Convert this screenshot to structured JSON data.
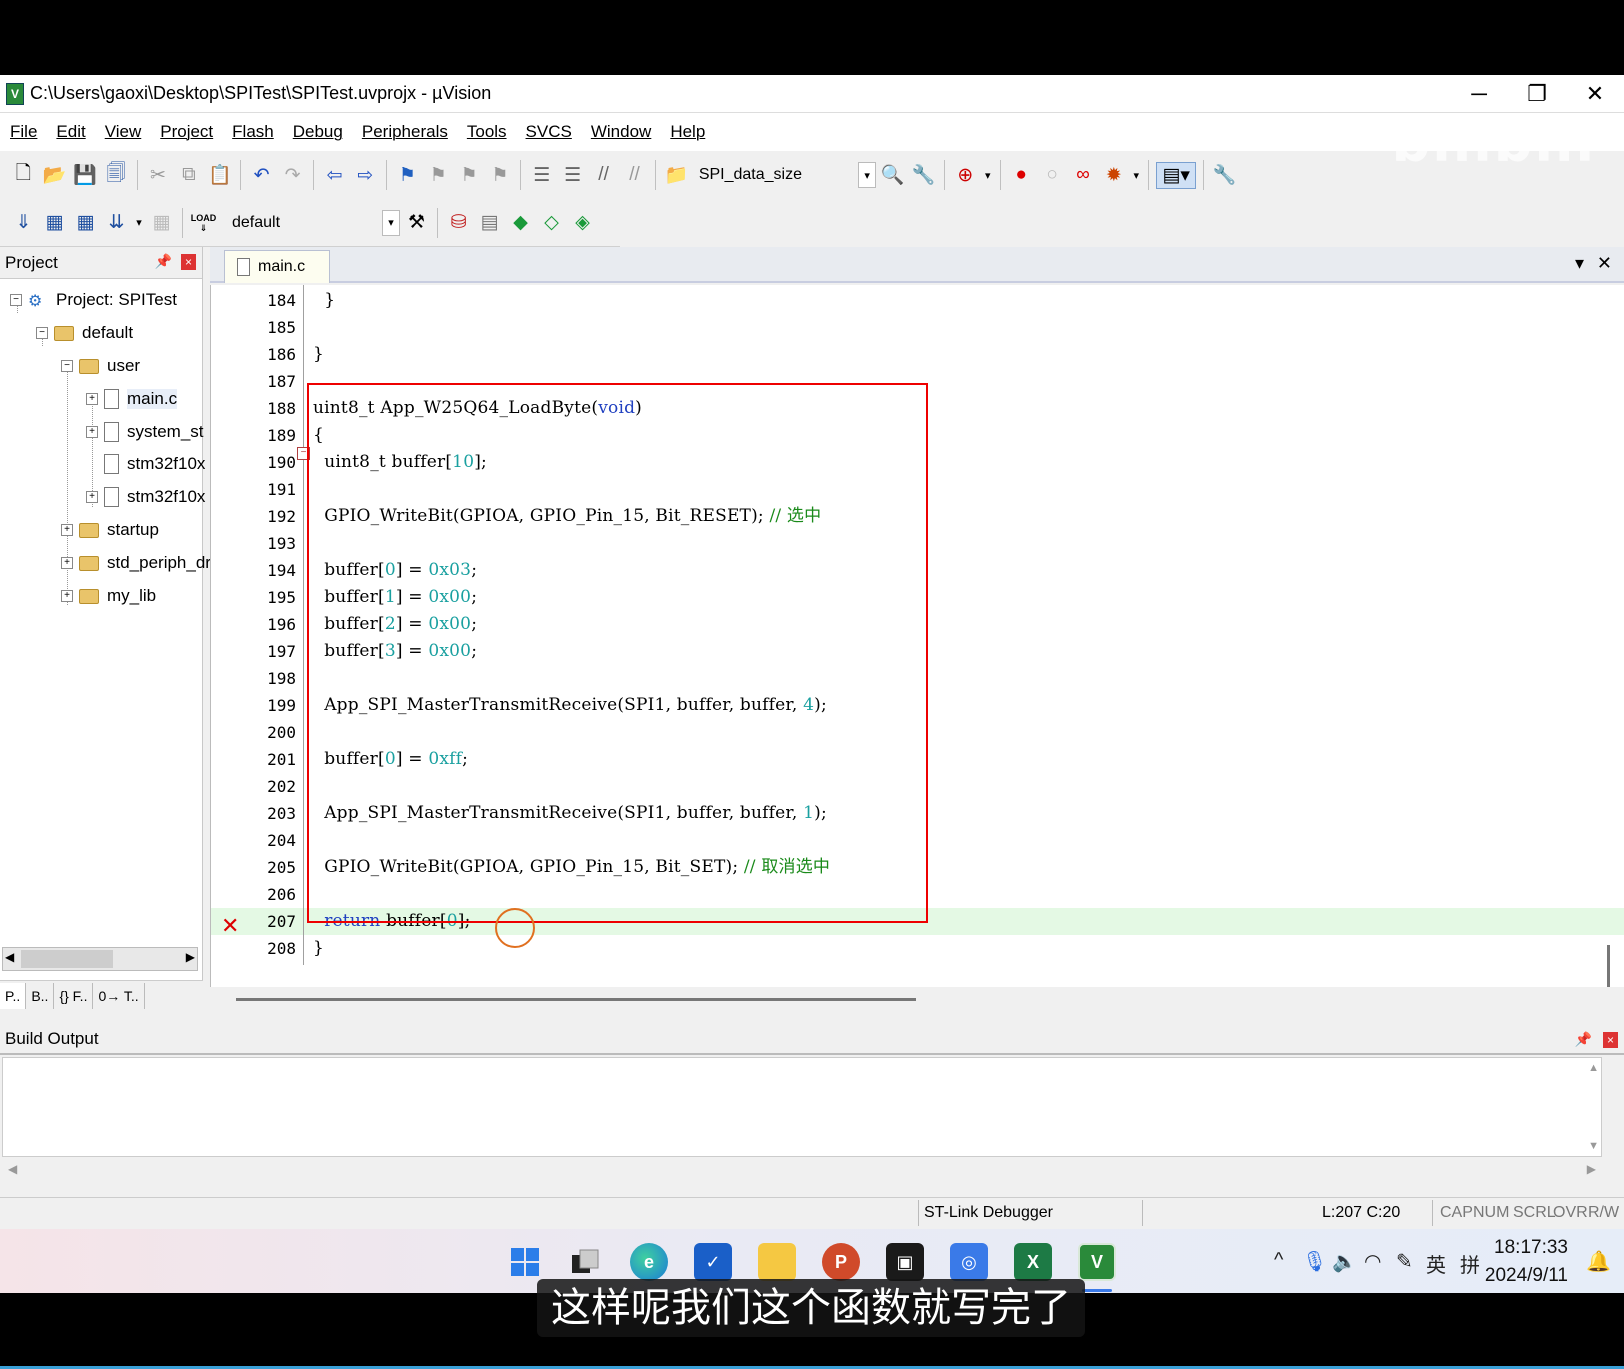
{
  "window": {
    "title": "C:\\Users\\gaoxi\\Desktop\\SPITest\\SPITest.uvprojx - µVision",
    "minimize": "─",
    "restore": "❐",
    "close": "✕"
  },
  "menu": [
    "File",
    "Edit",
    "View",
    "Project",
    "Flash",
    "Debug",
    "Peripherals",
    "Tools",
    "SVCS",
    "Window",
    "Help"
  ],
  "toolbar": {
    "find_combo_value": "SPI_data_size",
    "target_combo_value": "default",
    "load_label": "LOAD"
  },
  "watermark": "bilibili",
  "project_panel": {
    "title": "Project",
    "tree": {
      "project": "Project: SPITest",
      "target": "default",
      "group_user": "user",
      "files": [
        "main.c",
        "system_st",
        "stm32f10x",
        "stm32f10x"
      ],
      "groups": [
        "startup",
        "std_periph_dr",
        "my_lib"
      ]
    },
    "tabs": [
      "P..",
      "B..",
      "{} F..",
      "0→ T.."
    ]
  },
  "editor": {
    "tab": "main.c",
    "current_line": "207",
    "lines": [
      {
        "n": "184",
        "code": "  }"
      },
      {
        "n": "185",
        "code": ""
      },
      {
        "n": "186",
        "code": "}"
      },
      {
        "n": "187",
        "code": ""
      },
      {
        "n": "188",
        "code": "uint8_t App_W25Q64_LoadByte(void)"
      },
      {
        "n": "189",
        "code": "{"
      },
      {
        "n": "190",
        "code": "  uint8_t buffer[10];"
      },
      {
        "n": "191",
        "code": ""
      },
      {
        "n": "192",
        "code": "  GPIO_WriteBit(GPIOA, GPIO_Pin_15, Bit_RESET); // 选中"
      },
      {
        "n": "193",
        "code": ""
      },
      {
        "n": "194",
        "code": "  buffer[0] = 0x03;"
      },
      {
        "n": "195",
        "code": "  buffer[1] = 0x00;"
      },
      {
        "n": "196",
        "code": "  buffer[2] = 0x00;"
      },
      {
        "n": "197",
        "code": "  buffer[3] = 0x00;"
      },
      {
        "n": "198",
        "code": ""
      },
      {
        "n": "199",
        "code": "  App_SPI_MasterTransmitReceive(SPI1, buffer, buffer, 4);"
      },
      {
        "n": "200",
        "code": ""
      },
      {
        "n": "201",
        "code": "  buffer[0] = 0xff;"
      },
      {
        "n": "202",
        "code": ""
      },
      {
        "n": "203",
        "code": "  App_SPI_MasterTransmitReceive(SPI1, buffer, buffer, 1);"
      },
      {
        "n": "204",
        "code": ""
      },
      {
        "n": "205",
        "code": "  GPIO_WriteBit(GPIOA, GPIO_Pin_15, Bit_SET); // 取消选中"
      },
      {
        "n": "206",
        "code": ""
      },
      {
        "n": "207",
        "code": "  return buffer[0];"
      },
      {
        "n": "208",
        "code": "}"
      }
    ],
    "colors": {
      "keyword": "#2040c0",
      "number": "#1aa0a0",
      "comment": "#1a8a1a",
      "current_line_bg": "#e4f9e4",
      "highlight_box": "#e00000"
    }
  },
  "build_output": {
    "title": "Build Output"
  },
  "statusbar": {
    "debugger": "ST-Link Debugger",
    "position": "L:207 C:20",
    "indicators": [
      "CAP",
      "NUM",
      "SCRL",
      "OVR",
      "R/W"
    ]
  },
  "taskbar": {
    "time": "18:17:33",
    "date": "2024/9/11",
    "ime_lang": "英",
    "ime_mode": "拼"
  },
  "subtitle": "这样呢我们这个函数就写完了"
}
